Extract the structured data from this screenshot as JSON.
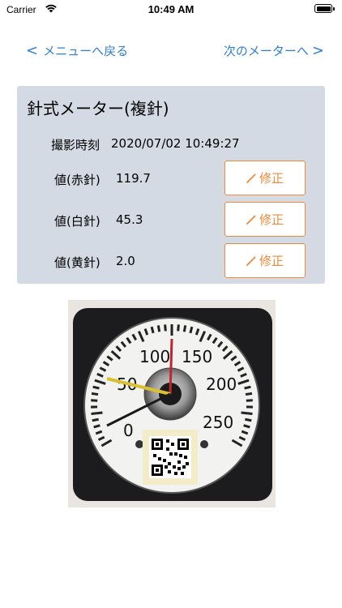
{
  "status_bar": {
    "carrier": "Carrier",
    "time": "10:49 AM"
  },
  "nav": {
    "back_label": "メニューへ戻る",
    "next_label": "次のメーターへ",
    "accent_color": "#2f7fd1"
  },
  "card": {
    "title": "針式メーター(複針)",
    "timestamp_label": "撮影時刻",
    "timestamp_value": "2020/07/02 10:49:27",
    "rows": [
      {
        "label": "値(赤針)",
        "value": "119.7",
        "button_label": "修正"
      },
      {
        "label": "値(白針)",
        "value": "45.3",
        "button_label": "修正"
      },
      {
        "label": "値(黄針)",
        "value": "2.0",
        "button_label": "修正"
      }
    ],
    "background_color": "#d3dae4",
    "button_color": "#ee8a3a"
  },
  "meter_image": {
    "scale_labels": [
      "0",
      "50",
      "100",
      "150",
      "200",
      "250"
    ]
  }
}
